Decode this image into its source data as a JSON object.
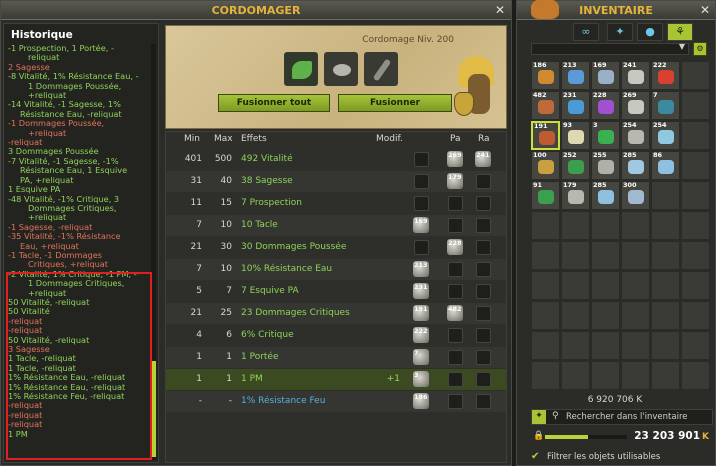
{
  "craft_window": {
    "title": "CORDOMAGER",
    "history": {
      "title": "Historique",
      "lines": [
        {
          "text": "-1 Prospection, 1 Portée, -",
          "color": "g",
          "indent": ""
        },
        {
          "text": "reliquat",
          "color": "g",
          "indent": "ind"
        },
        {
          "text": "2 Sagesse",
          "color": "r",
          "indent": ""
        },
        {
          "text": "-8 Vitalité, 1% Résistance Eau, -",
          "color": "g",
          "indent": ""
        },
        {
          "text": "1 Dommages Poussée,",
          "color": "g",
          "indent": "ind"
        },
        {
          "text": "+reliquat",
          "color": "g",
          "indent": "ind"
        },
        {
          "text": "-14 Vitalité, -1 Sagesse, 1%",
          "color": "g",
          "indent": ""
        },
        {
          "text": "Résistance Eau, -reliquat",
          "color": "g",
          "indent": "ind2"
        },
        {
          "text": "-1 Dommages Poussée,",
          "color": "r",
          "indent": ""
        },
        {
          "text": "+reliquat",
          "color": "r",
          "indent": "ind"
        },
        {
          "text": "-reliquat",
          "color": "r",
          "indent": ""
        },
        {
          "text": "3 Dommages Poussée",
          "color": "g",
          "indent": ""
        },
        {
          "text": "-7 Vitalité, -1 Sagesse, -1%",
          "color": "g",
          "indent": ""
        },
        {
          "text": "Résistance Eau, 1 Esquive",
          "color": "g",
          "indent": "ind2"
        },
        {
          "text": "PA, +reliquat",
          "color": "g",
          "indent": "ind2"
        },
        {
          "text": "1 Esquive PA",
          "color": "g",
          "indent": ""
        },
        {
          "text": "-48 Vitalité, -1% Critique, 3",
          "color": "g",
          "indent": ""
        },
        {
          "text": "Dommages Critiques,",
          "color": "g",
          "indent": "ind"
        },
        {
          "text": "+reliquat",
          "color": "g",
          "indent": "ind"
        },
        {
          "text": "-1 Sagesse, -reliquat",
          "color": "r",
          "indent": ""
        },
        {
          "text": "-35 Vitalité, -1% Résistance",
          "color": "r",
          "indent": ""
        },
        {
          "text": "Eau, +reliquat",
          "color": "r",
          "indent": "ind2"
        },
        {
          "text": "-1 Tacle, -1 Dommages",
          "color": "r",
          "indent": ""
        },
        {
          "text": "Critiques, +reliquat",
          "color": "r",
          "indent": "ind"
        },
        {
          "text": "-2 Vitalité, 1% Critique, -1 PM, -",
          "color": "g",
          "indent": ""
        },
        {
          "text": "1 Dommages Critiques,",
          "color": "g",
          "indent": "ind"
        },
        {
          "text": "+reliquat",
          "color": "g",
          "indent": "ind"
        },
        {
          "text": "50 Vitalité, -reliquat",
          "color": "g",
          "indent": ""
        },
        {
          "text": "50 Vitalité",
          "color": "g",
          "indent": ""
        },
        {
          "text": "-reliquat",
          "color": "r",
          "indent": ""
        },
        {
          "text": "-reliquat",
          "color": "r",
          "indent": ""
        },
        {
          "text": "50 Vitalité, -reliquat",
          "color": "g",
          "indent": ""
        },
        {
          "text": "3 Sagesse",
          "color": "r",
          "indent": ""
        },
        {
          "text": "1 Tacle, -reliquat",
          "color": "g",
          "indent": ""
        },
        {
          "text": "1 Tacle, -reliquat",
          "color": "g",
          "indent": ""
        },
        {
          "text": "1% Résistance Eau, -reliquat",
          "color": "g",
          "indent": ""
        },
        {
          "text": "1% Résistance Eau, -reliquat",
          "color": "g",
          "indent": ""
        },
        {
          "text": "1% Résistance Feu, -reliquat",
          "color": "g",
          "indent": ""
        },
        {
          "text": "-reliquat",
          "color": "r",
          "indent": ""
        },
        {
          "text": "-reliquat",
          "color": "r",
          "indent": ""
        },
        {
          "text": "-reliquat",
          "color": "r",
          "indent": ""
        },
        {
          "text": "1 PM",
          "color": "g",
          "indent": ""
        }
      ]
    },
    "craft": {
      "level_label": "Cordomage Niv. 200",
      "merge_all_label": "Fusionner tout",
      "merge_label": "Fusionner"
    },
    "effects_table": {
      "headers": {
        "min": "Min",
        "max": "Max",
        "effects": "Effets",
        "modif": "Modif.",
        "pa": "Pa",
        "ra": "Ra"
      },
      "rows": [
        {
          "min": "401",
          "max": "500",
          "effect": "492 Vitalité",
          "modif": "",
          "rune_mi": "",
          "rune_pa": "269",
          "rune_ra": "241",
          "blue": false
        },
        {
          "min": "31",
          "max": "40",
          "effect": "38 Sagesse",
          "modif": "",
          "rune_mi": "",
          "rune_pa": "179",
          "rune_ra": "",
          "blue": false
        },
        {
          "min": "11",
          "max": "15",
          "effect": "7 Prospection",
          "modif": "",
          "rune_mi": "",
          "rune_pa": "",
          "rune_ra": "",
          "blue": false
        },
        {
          "min": "7",
          "max": "10",
          "effect": "10 Tacle",
          "modif": "",
          "rune_mi": "169",
          "rune_pa": "",
          "rune_ra": "",
          "blue": false
        },
        {
          "min": "21",
          "max": "30",
          "effect": "30 Dommages Poussée",
          "modif": "",
          "rune_mi": "",
          "rune_pa": "228",
          "rune_ra": "",
          "blue": false
        },
        {
          "min": "7",
          "max": "10",
          "effect": "10% Résistance Eau",
          "modif": "",
          "rune_mi": "213",
          "rune_pa": "",
          "rune_ra": "",
          "blue": false
        },
        {
          "min": "5",
          "max": "7",
          "effect": "7 Esquive PA",
          "modif": "",
          "rune_mi": "231",
          "rune_pa": "",
          "rune_ra": "",
          "blue": false
        },
        {
          "min": "21",
          "max": "25",
          "effect": "23 Dommages Critiques",
          "modif": "",
          "rune_mi": "191",
          "rune_pa": "482",
          "rune_ra": "",
          "blue": false
        },
        {
          "min": "4",
          "max": "6",
          "effect": "6% Critique",
          "modif": "",
          "rune_mi": "222",
          "rune_pa": "",
          "rune_ra": "",
          "blue": false
        },
        {
          "min": "1",
          "max": "1",
          "effect": "1 Portée",
          "modif": "",
          "rune_mi": "7",
          "rune_pa": "",
          "rune_ra": "",
          "blue": false
        },
        {
          "min": "1",
          "max": "1",
          "effect": "1 PM",
          "modif": "+1",
          "rune_mi": "3",
          "rune_pa": "",
          "rune_ra": "",
          "blue": false
        },
        {
          "min": "-",
          "max": "-",
          "effect": "1% Résistance Feu",
          "modif": "",
          "rune_mi": "186",
          "rune_pa": "",
          "rune_ra": "",
          "blue": true
        }
      ]
    }
  },
  "inventory_window": {
    "title": "INVENTAIRE",
    "tabs": [
      "∞",
      "✦",
      "●",
      "⚘"
    ],
    "items": [
      {
        "qty": "186",
        "color": "#d08a30"
      },
      {
        "qty": "213",
        "color": "#5a9ad8"
      },
      {
        "qty": "169",
        "color": "#9ab0c8"
      },
      {
        "qty": "241",
        "color": "#c8c8c0"
      },
      {
        "qty": "222",
        "color": "#d84030"
      },
      {
        "qty": "482",
        "color": "#c06a3a"
      },
      {
        "qty": "231",
        "color": "#4a9ad8"
      },
      {
        "qty": "228",
        "color": "#a050d0"
      },
      {
        "qty": "269",
        "color": "#c8c8c0"
      },
      {
        "qty": "7",
        "color": "#3a8aa0"
      },
      {
        "qty": "191",
        "color": "#c05a30"
      },
      {
        "qty": "93",
        "color": "#e0d8b0"
      },
      {
        "qty": "3",
        "color": "#3ab050"
      },
      {
        "qty": "254",
        "color": "#b8b8b0"
      },
      {
        "qty": "254",
        "color": "#90c8e0"
      },
      {
        "qty": "100",
        "color": "#c8a040"
      },
      {
        "qty": "252",
        "color": "#3aa050"
      },
      {
        "qty": "255",
        "color": "#b0b0a8"
      },
      {
        "qty": "285",
        "color": "#a0c8e0"
      },
      {
        "qty": "86",
        "color": "#90c0e0"
      },
      {
        "qty": "91",
        "color": "#3aa050"
      },
      {
        "qty": "179",
        "color": "#b8b8b0"
      },
      {
        "qty": "285",
        "color": "#90c0e0"
      },
      {
        "qty": "300",
        "color": "#a0b8d0"
      }
    ],
    "weight_label": "6 920 706 K",
    "search_placeholder": "Rechercher dans l'inventaire",
    "kamas": "23 203 901",
    "kamas_icon": "K",
    "pods_fill": 0.52,
    "filter_label": "Filtrer les objets utilisables"
  }
}
